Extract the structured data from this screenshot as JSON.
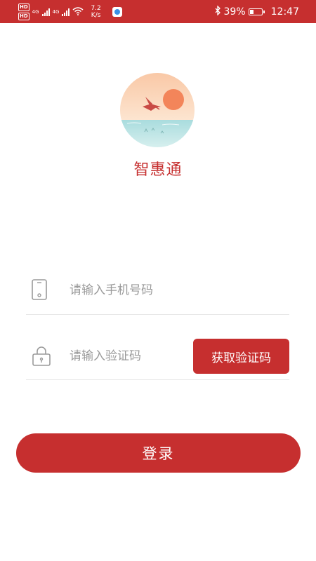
{
  "status_bar": {
    "hd1": "HD",
    "hd2": "HD",
    "net1": "4G",
    "net2": "4G",
    "speed_value": "7.2",
    "speed_unit": "K/s",
    "battery_percent": "39%",
    "battery_level": 0.39,
    "time": "12:47",
    "icons": [
      "signal-icon",
      "wifi-icon",
      "bluetooth-icon",
      "battery-icon",
      "app-notification-icon"
    ]
  },
  "app": {
    "name": "智惠通"
  },
  "form": {
    "phone_placeholder": "请输入手机号码",
    "code_placeholder": "请输入验证码",
    "get_code_label": "获取验证码",
    "login_label": "登录"
  },
  "colors": {
    "accent": "#c62f2f",
    "divider": "#e8e8e8",
    "placeholder": "#9a9a9a"
  }
}
